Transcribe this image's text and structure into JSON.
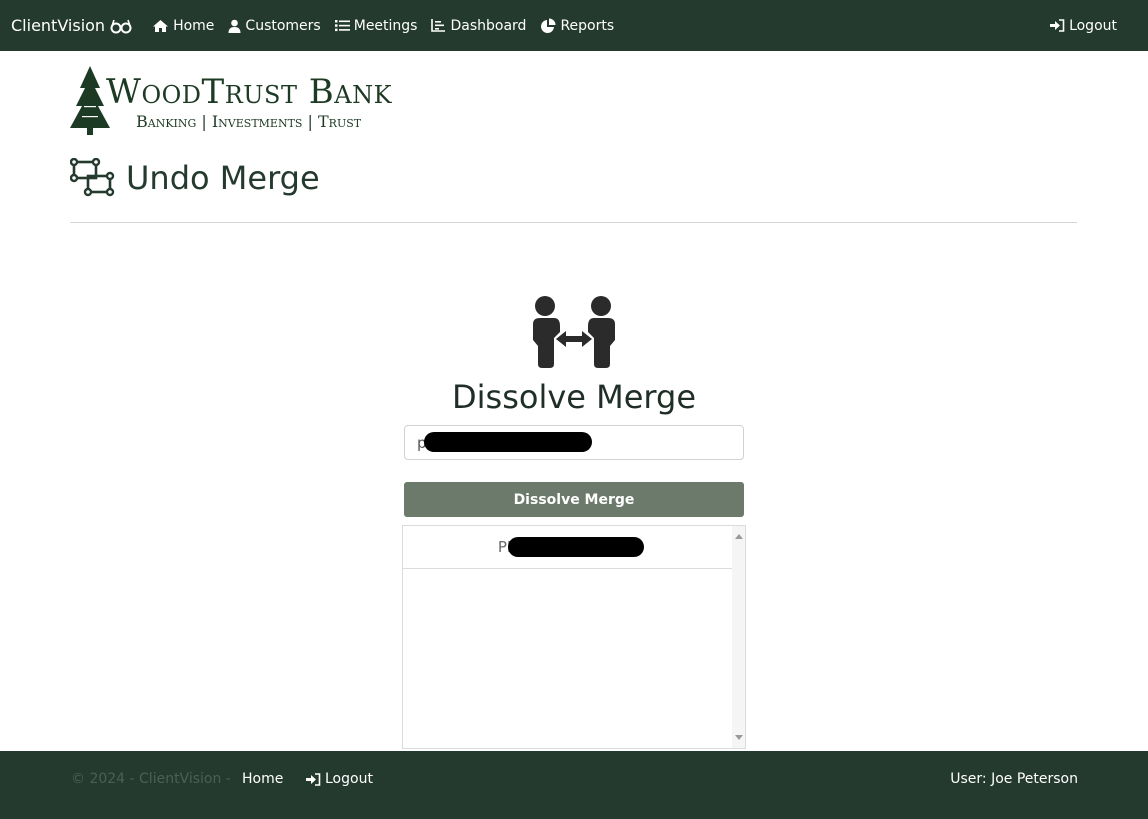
{
  "navbar": {
    "brand": "ClientVision",
    "items": [
      {
        "label": "Home",
        "icon": "home-icon"
      },
      {
        "label": "Customers",
        "icon": "user-icon"
      },
      {
        "label": "Meetings",
        "icon": "list-icon"
      },
      {
        "label": "Dashboard",
        "icon": "chart-icon"
      },
      {
        "label": "Reports",
        "icon": "pie-chart-icon"
      }
    ],
    "logout": "Logout"
  },
  "logo": {
    "name": "WoodTrust Bank",
    "tagline": "Banking | Investments | Trust"
  },
  "page": {
    "title": "Undo Merge"
  },
  "merge_card": {
    "title": "Dissolve Merge",
    "input_value": "pl",
    "button_label": "Dissolve Merge",
    "results": [
      "PH"
    ]
  },
  "footer": {
    "copyright": "© 2024 - ClientVision -",
    "home": "Home",
    "logout": "Logout",
    "user": "User: Joe Peterson"
  },
  "colors": {
    "navbar_bg": "#243a2e",
    "button_bg": "#6b7a6a",
    "title": "#243a2e"
  }
}
